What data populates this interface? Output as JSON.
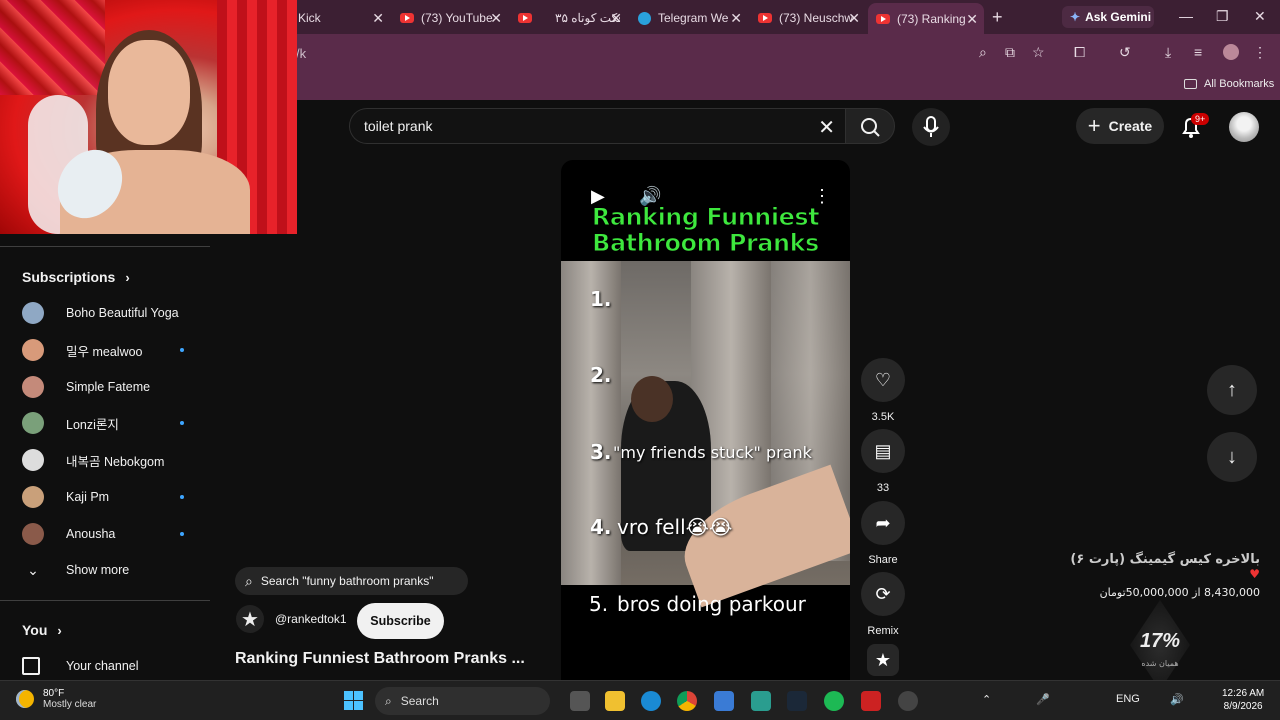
{
  "browser": {
    "tabs": [
      {
        "title": "Kick",
        "icon": "kick-icon"
      },
      {
        "title": "(73) YouTube",
        "icon": "youtube-icon"
      },
      {
        "title": "۳۵ فکت کوتاه",
        "icon": "youtube-icon"
      },
      {
        "title": "Telegram We",
        "icon": "telegram-icon"
      },
      {
        "title": "(73) Neuschw",
        "icon": "youtube-icon"
      },
      {
        "title": "(73) Ranking",
        "icon": "youtube-icon",
        "active": true
      }
    ],
    "new_tab": "+",
    "gemini_label": "Ask Gemini",
    "url_fragment": "/k",
    "all_bookmarks": "All Bookmarks"
  },
  "header": {
    "search_value": "toilet prank",
    "create_label": "Create",
    "notifications_badge": "9+"
  },
  "sidebar": {
    "subscriptions_label": "Subscriptions",
    "items": [
      {
        "label": "Boho Beautiful Yoga",
        "new": false,
        "color": "#8fa8c4"
      },
      {
        "label": "밀우 mealwoo",
        "new": true,
        "color": "#d89a7a"
      },
      {
        "label": "Simple Fateme",
        "new": false,
        "color": "#c48a7a"
      },
      {
        "label": "Lonzi론지",
        "new": true,
        "color": "#7aa07a"
      },
      {
        "label": "내복곰 Nebokgom",
        "new": false,
        "color": "#dddddd"
      },
      {
        "label": "Kaji Pm",
        "new": true,
        "color": "#c9a07a"
      },
      {
        "label": "Anousha",
        "new": true,
        "color": "#8a5a4a"
      }
    ],
    "show_more": "Show more",
    "you_label": "You",
    "your_channel": "Your channel"
  },
  "short": {
    "title": "Ranking Funniest Bathroom Pranks",
    "list": [
      {
        "num": "1.",
        "text": ""
      },
      {
        "num": "2.",
        "text": ""
      },
      {
        "num": "3.",
        "text": "\"my friends stuck\" prank"
      },
      {
        "num": "4.",
        "text": "vro fell😭😭"
      },
      {
        "num": "5.",
        "text": "bros doing parkour"
      }
    ],
    "likes": "3.5K",
    "comments": "33",
    "share_label": "Share",
    "remix_label": "Remix",
    "related_search": "Search \"funny bathroom pranks\"",
    "channel_handle": "@rankedtok1",
    "subscribe_label": "Subscribe",
    "video_title": "Ranking Funniest Bathroom Pranks ..."
  },
  "donation": {
    "title": "بالاخره کیس گیمینگ (پارت ۶)",
    "progress": "8,430,000 از 50,000,000تومان",
    "percent": "17%",
    "percent_sub": "همیان شده"
  },
  "taskbar": {
    "temp": "80°F",
    "weather": "Mostly clear",
    "search_label": "Search",
    "lang": "ENG",
    "time": "12:26 AM",
    "date": "8/9/2026"
  }
}
